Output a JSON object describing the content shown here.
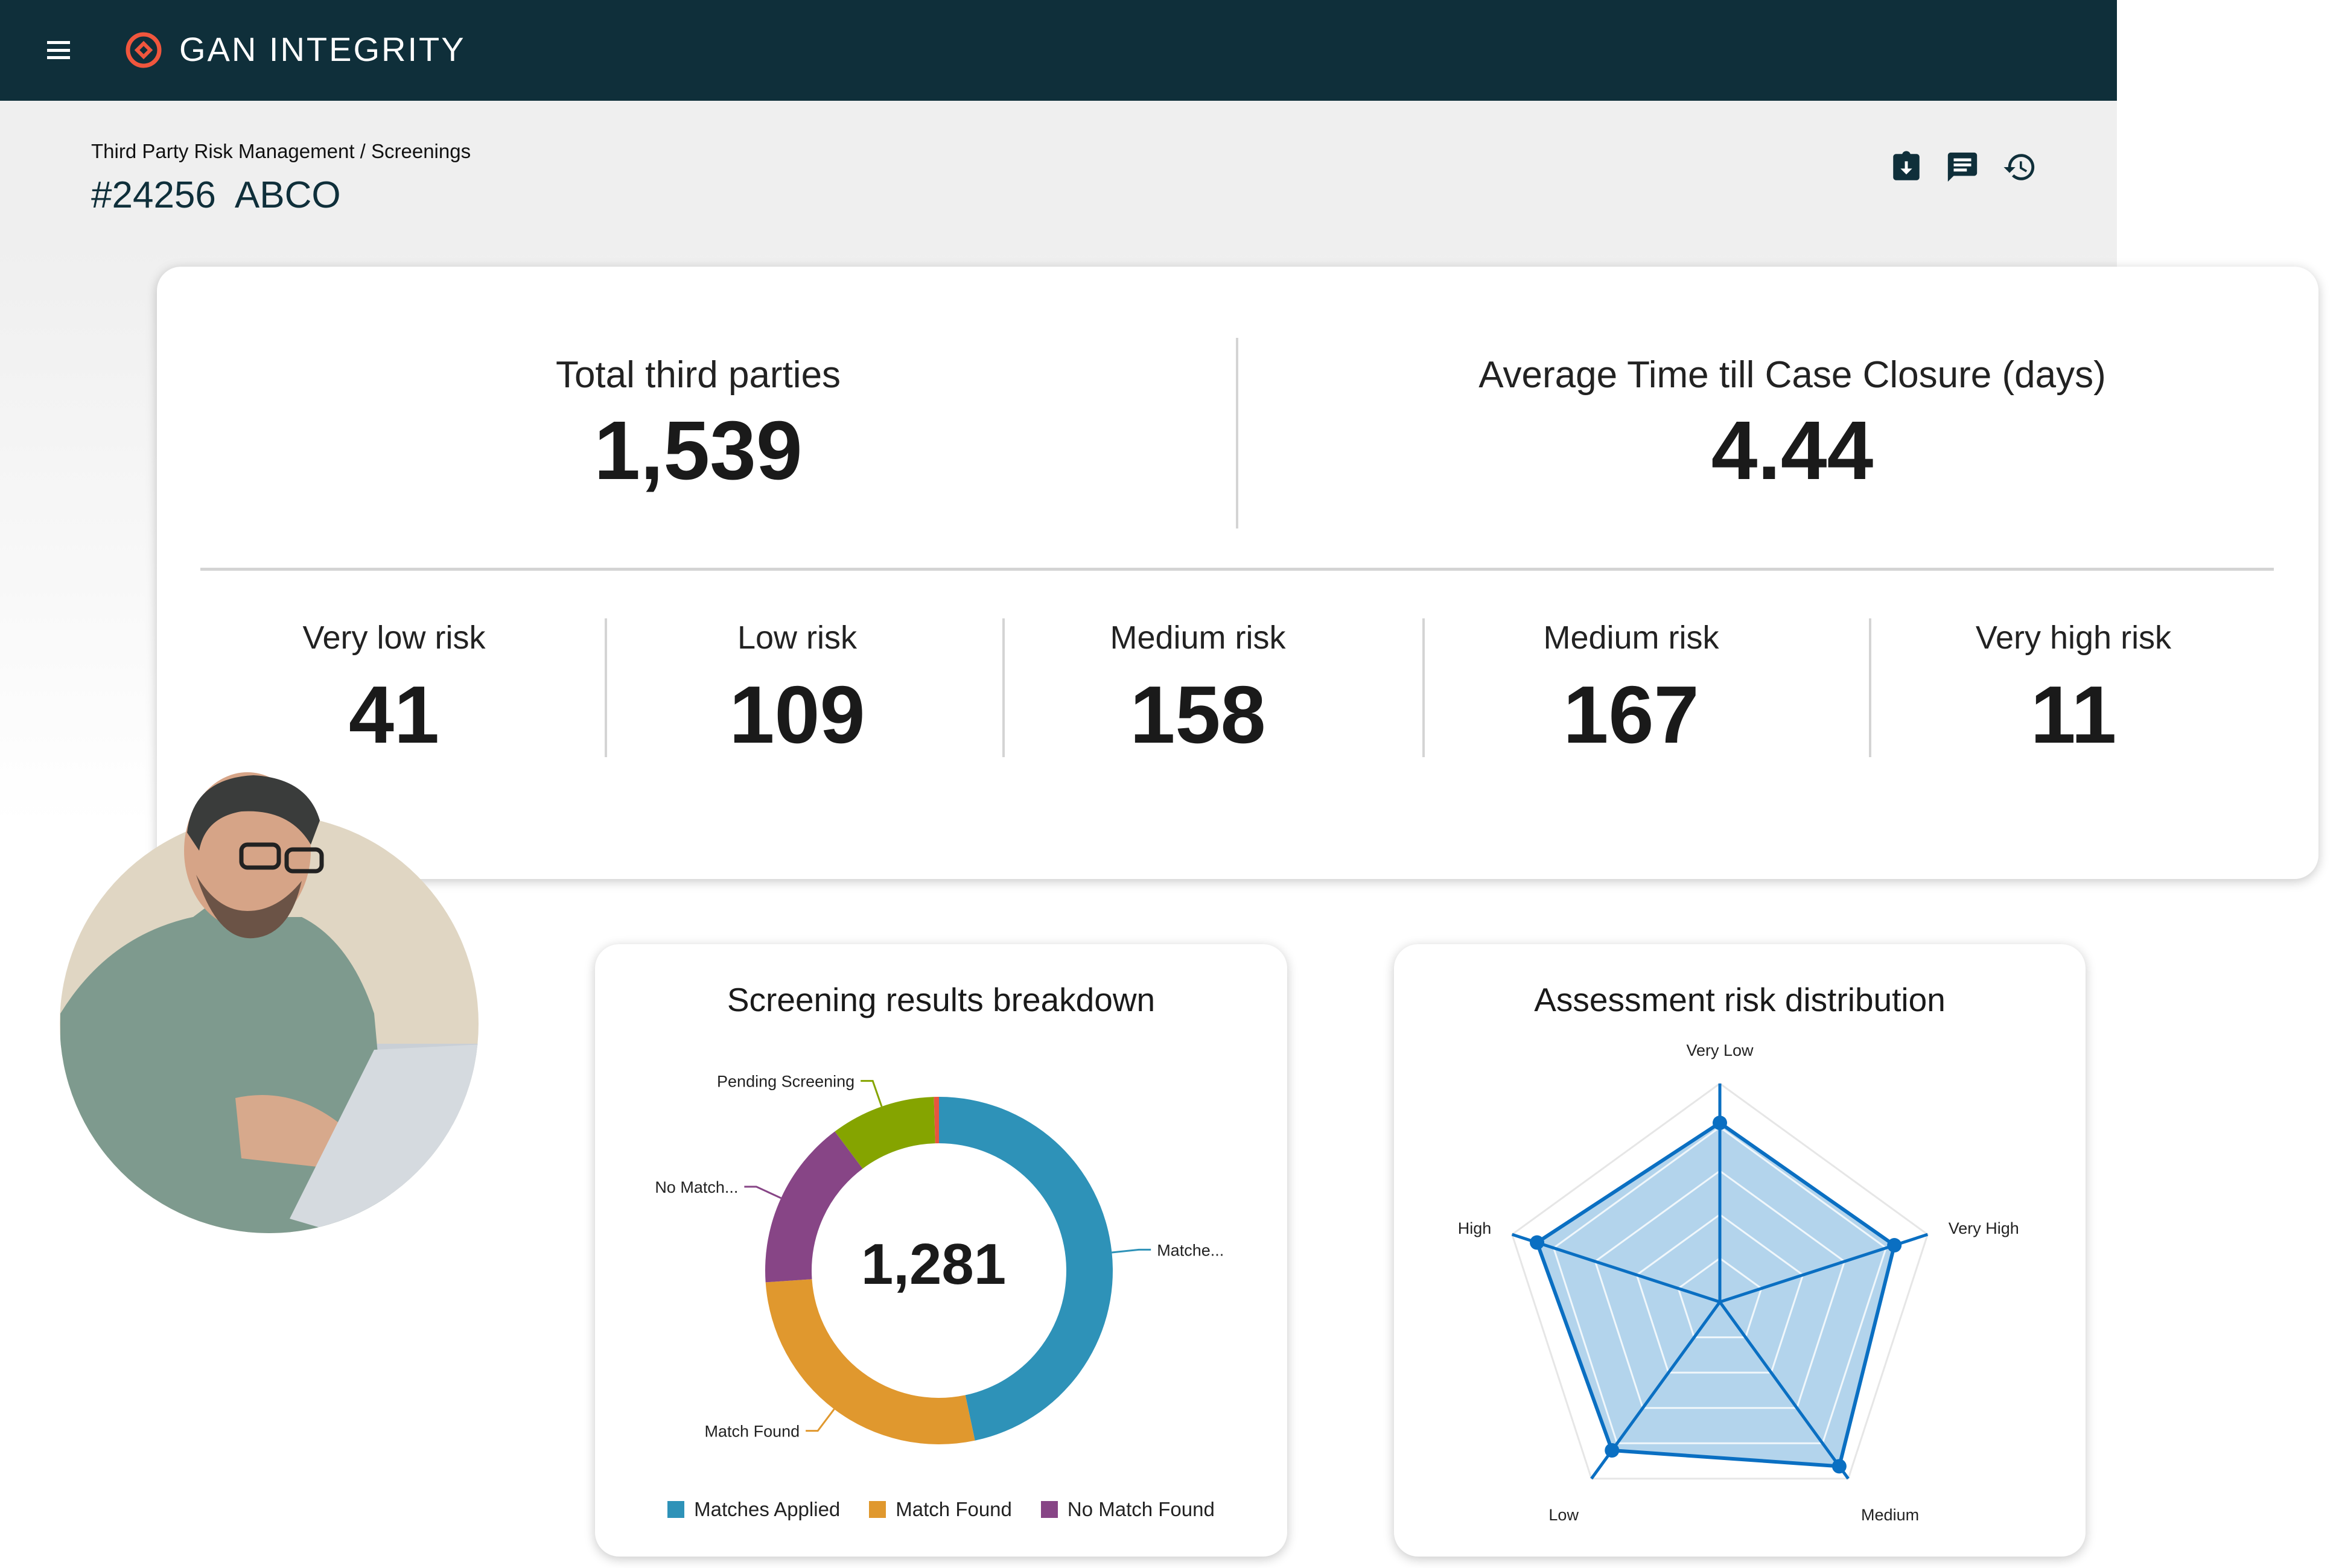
{
  "header": {
    "brand": "GAN INTEGRITY",
    "menu_icon": "hamburger-icon",
    "logo_color": "#f0563d",
    "bg_color": "#0f2f3a"
  },
  "page": {
    "breadcrumb": "Third Party Risk Management / Screenings",
    "title": "#24256  ABCO",
    "actions": [
      {
        "icon": "clipboard-download-icon"
      },
      {
        "icon": "comment-icon"
      },
      {
        "icon": "history-icon"
      }
    ]
  },
  "summary": {
    "total": {
      "label": "Total third parties",
      "value": "1,539"
    },
    "avg_time": {
      "label": "Average Time till Case Closure (days)",
      "value": "4.44"
    },
    "risks": [
      {
        "label": "Very low risk",
        "value": "41"
      },
      {
        "label": "Low risk",
        "value": "109"
      },
      {
        "label": "Medium risk",
        "value": "158"
      },
      {
        "label": "Medium risk",
        "value": "167"
      },
      {
        "label": "Very high risk",
        "value": "11"
      }
    ]
  },
  "chart_data": [
    {
      "type": "pie",
      "title": "Screening results breakdown",
      "center_label": "1,281",
      "slices": [
        {
          "name": "Matches Applied",
          "label": "Matche...",
          "value": 598,
          "color": "#2e92b8"
        },
        {
          "name": "Match Found",
          "label": "Match Found",
          "value": 349,
          "color": "#e0982e"
        },
        {
          "name": "No Match Found",
          "label": "No Match...",
          "value": 203,
          "color": "#874586"
        },
        {
          "name": "Pending Screening",
          "label": "Pending Screening",
          "value": 125,
          "color": "#85a400"
        },
        {
          "name": "",
          "label": "",
          "value": 6,
          "color": "#e8553f"
        }
      ],
      "legend": [
        "Matches Applied",
        "Match Found",
        "No Match Found"
      ],
      "legend_position": "bottom"
    },
    {
      "type": "radar",
      "title": "Assessment risk distribution",
      "axes": [
        "Very Low",
        "Very High",
        "Medium",
        "Low",
        "High"
      ],
      "values": [
        0.82,
        0.84,
        0.93,
        0.84,
        0.88
      ],
      "range": [
        0,
        1
      ],
      "grid_levels": 5,
      "color": "#0a6fc2",
      "fill": "#b3d4ec"
    }
  ]
}
